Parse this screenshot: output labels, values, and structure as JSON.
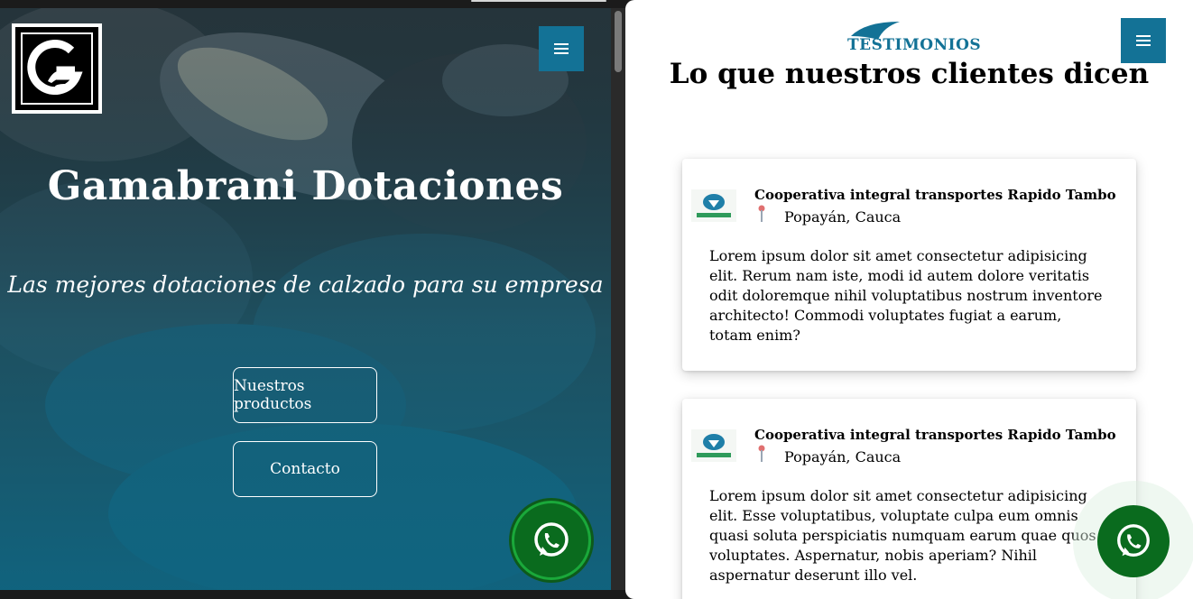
{
  "colors": {
    "accent": "#137296",
    "whatsapp": "#0a6b1e",
    "hero_overlay": "#13627c"
  },
  "left": {
    "logo_icon": "gamabrani-logo-icon",
    "menu_icon": "hamburger-menu-icon",
    "hero": {
      "title": "Gamabrani Dotaciones",
      "subtitle": "Las mejores dotaciones de calzado para su empresa",
      "buttons": {
        "products": "Nuestros productos",
        "contact": "Contacto"
      }
    },
    "whatsapp_icon": "whatsapp-icon"
  },
  "right": {
    "menu_icon": "hamburger-menu-icon",
    "section_logo": "TESTIMONIOS",
    "section_title": "Lo que nuestros clientes dicen",
    "testimonials": [
      {
        "company": "Cooperativa integral transportes Rapido Tambo",
        "location": "Popayán, Cauca",
        "text": "Lorem ipsum dolor sit amet consectetur adipisicing elit. Rerum nam iste, modi id autem dolore veritatis odit doloremque nihil voluptatibus nostrum inventore architecto! Commodi voluptates fugiat a earum, totam enim?"
      },
      {
        "company": "Cooperativa integral transportes Rapido Tambo",
        "location": "Popayán, Cauca",
        "text": "Lorem ipsum dolor sit amet consectetur adipisicing elit. Esse voluptatibus, voluptate culpa eum omnis quasi soluta perspiciatis numquam earum quae quos voluptates. Aspernatur, nobis aperiam? Nihil aspernatur deserunt illo vel."
      }
    ],
    "whatsapp_icon": "whatsapp-icon"
  }
}
